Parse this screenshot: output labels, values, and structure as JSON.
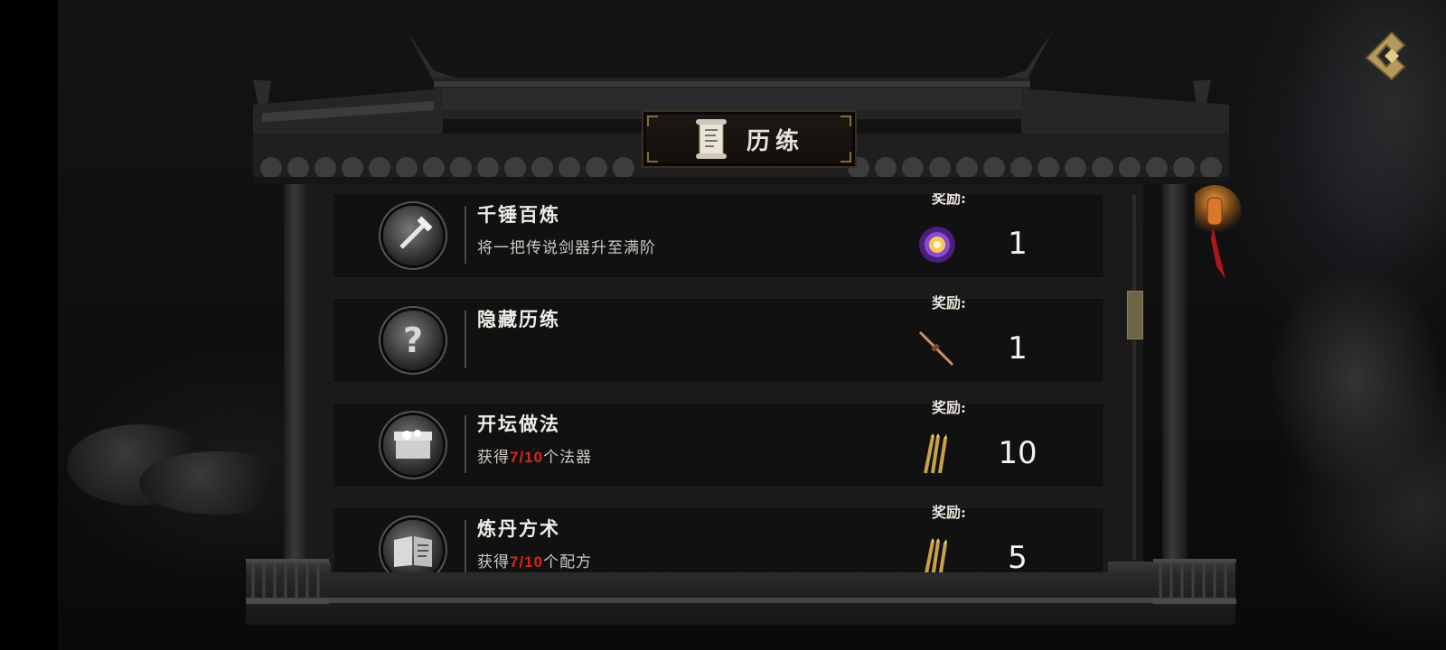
{
  "header": {
    "title": "历练"
  },
  "reward_label": "奖励:",
  "tasks": [
    {
      "name": "千锤百炼",
      "desc_before": "将一把传说剑器升至满阶",
      "progress": "",
      "desc_after": "",
      "reward_icon": "purple-orb-icon",
      "reward_count": "1"
    },
    {
      "name": "隐藏历练",
      "desc_before": "",
      "progress": "",
      "desc_after": "",
      "reward_icon": "sword-icon",
      "reward_count": "1"
    },
    {
      "name": "开坛做法",
      "desc_before": "获得",
      "progress": "7/10",
      "desc_after": "个法器",
      "reward_icon": "golden-arrows-icon",
      "reward_count": "10"
    },
    {
      "name": "炼丹方术",
      "desc_before": "获得",
      "progress": "7/10",
      "desc_after": "个配方",
      "reward_icon": "golden-arrows-icon",
      "reward_count": "5"
    }
  ],
  "colors": {
    "progress": "#d9251c",
    "accent_gold": "#c9a14a",
    "panel": "#111112"
  }
}
